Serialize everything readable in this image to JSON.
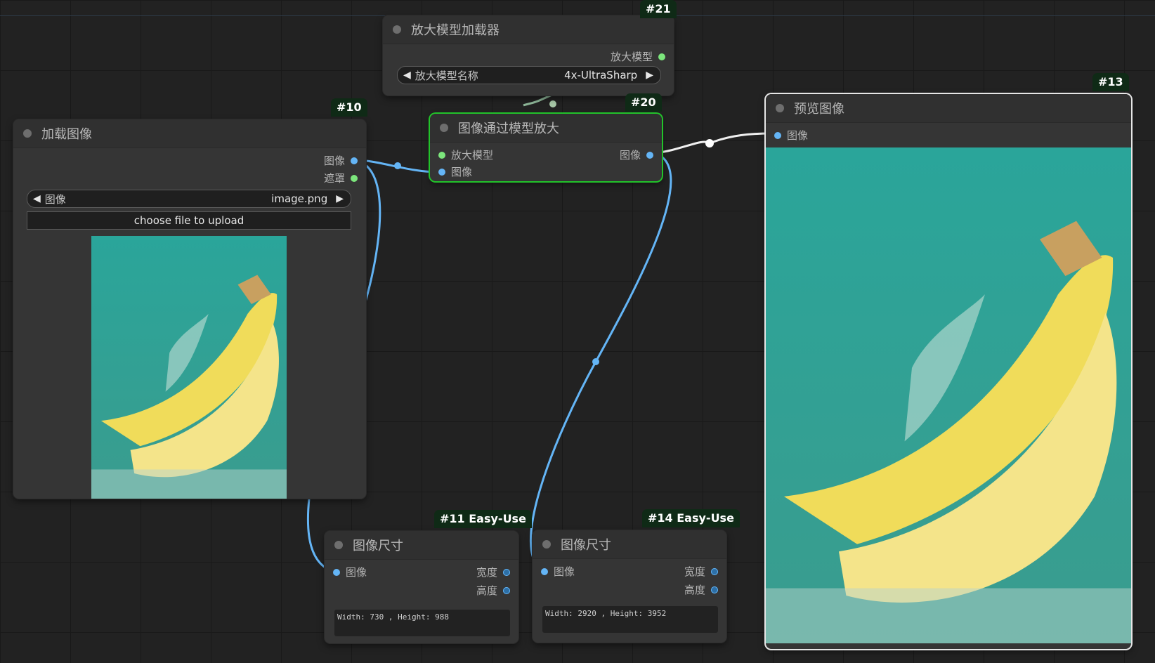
{
  "nodes": {
    "upscale_loader": {
      "id": "#21",
      "title": "放大模型加载器",
      "output": "放大模型",
      "combo_label": "放大模型名称",
      "combo_value": "4x-UltraSharp"
    },
    "load_image": {
      "id": "#10",
      "title": "加载图像",
      "outputs": [
        "图像",
        "遮罩"
      ],
      "combo_label": "图像",
      "combo_value": "image.png",
      "upload_label": "choose file to upload"
    },
    "upscale_with_model": {
      "id": "#20",
      "title": "图像通过模型放大",
      "inputs": [
        "放大模型",
        "图像"
      ],
      "output": "图像"
    },
    "preview": {
      "id": "#13",
      "title": "预览图像",
      "input": "图像"
    },
    "size_a": {
      "id": "#11 Easy-Use",
      "title": "图像尺寸",
      "input": "图像",
      "outputs": [
        "宽度",
        "高度"
      ],
      "text": "Width: 730 , Height: 988"
    },
    "size_b": {
      "id": "#14 Easy-Use",
      "title": "图像尺寸",
      "input": "图像",
      "outputs": [
        "宽度",
        "高度"
      ],
      "text": "Width: 2920 , Height: 3952"
    }
  },
  "colors": {
    "canvas": "#222222",
    "image_link": "#64b5f6",
    "model_link": "#7ce67c",
    "selected_border": "#22c32a",
    "badge_bg": "#0f2a16"
  }
}
